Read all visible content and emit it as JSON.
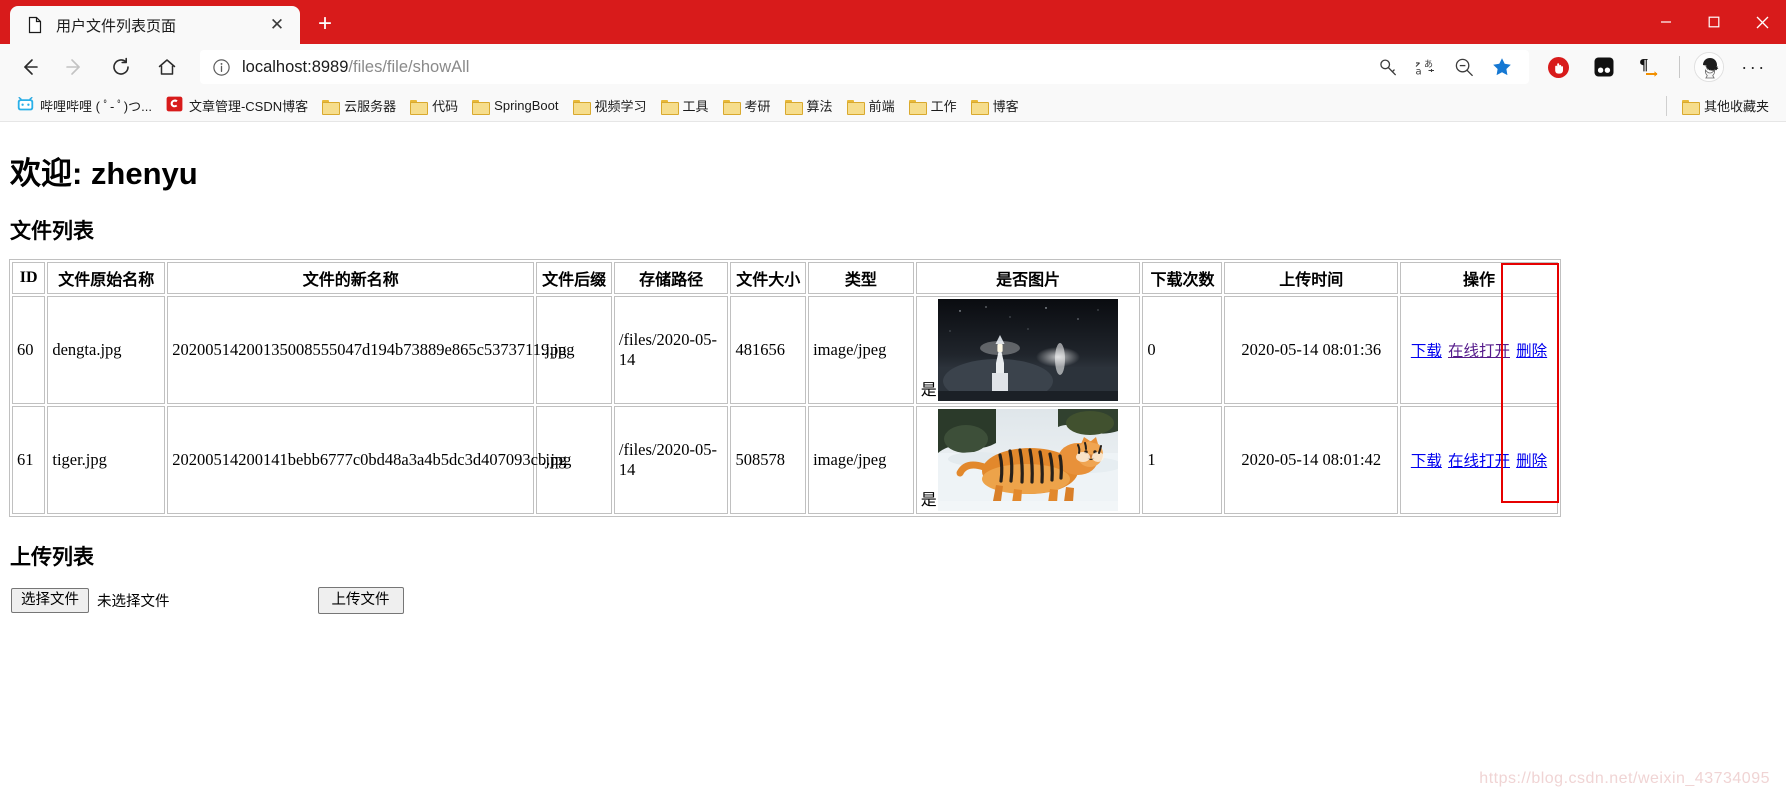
{
  "browser": {
    "tab": {
      "title": "用户文件列表页面",
      "favicon": "page-icon",
      "close": "✕"
    },
    "new_tab": "+",
    "window_controls": {
      "minimize": "minimize-icon",
      "maximize": "maximize-icon",
      "close": "close-icon"
    },
    "nav": {
      "back": "back-arrow-icon",
      "forward": "forward-arrow-icon",
      "reload": "reload-icon",
      "home": "home-icon"
    },
    "address": {
      "info_icon": "info-icon",
      "url_host": "localhost:8989",
      "url_path": "/files/file/showAll",
      "icons": [
        "key-icon",
        "translate-icon",
        "zoom-out-icon",
        "favorites-star-icon"
      ]
    },
    "extensions": [
      "adblock-stop-icon",
      "dark-reader-icon",
      "paragraph-arrow-icon"
    ],
    "profile": "avatar",
    "more": "···",
    "bookmarks": [
      {
        "icon": "bilibili-icon",
        "label": "哔哩哔哩 ( ﾟ- ﾟ)つ..."
      },
      {
        "icon": "csdn-icon",
        "label": "文章管理-CSDN博客"
      },
      {
        "icon": "folder-icon",
        "label": "云服务器"
      },
      {
        "icon": "folder-icon",
        "label": "代码"
      },
      {
        "icon": "folder-icon",
        "label": "SpringBoot"
      },
      {
        "icon": "folder-icon",
        "label": "视频学习"
      },
      {
        "icon": "folder-icon",
        "label": "工具"
      },
      {
        "icon": "folder-icon",
        "label": "考研"
      },
      {
        "icon": "folder-icon",
        "label": "算法"
      },
      {
        "icon": "folder-icon",
        "label": "前端"
      },
      {
        "icon": "folder-icon",
        "label": "工作"
      },
      {
        "icon": "folder-icon",
        "label": "博客"
      }
    ],
    "bookmarks_other": {
      "icon": "folder-icon",
      "label": "其他收藏夹"
    }
  },
  "page": {
    "welcome": "欢迎: zhenyu",
    "file_list_heading": "文件列表",
    "upload_heading": "上传列表",
    "table": {
      "columns": [
        "ID",
        "文件原始名称",
        "文件的新名称",
        "文件后缀",
        "存储路径",
        "文件大小",
        "类型",
        "是否图片",
        "下载次数",
        "上传时间",
        "操作"
      ],
      "rows": [
        {
          "id": "60",
          "original_name": "dengta.jpg",
          "new_name": "20200514200135008555047d194b73889e865c53737119.jpg",
          "ext": ".jpg",
          "path": "/files/2020-05-14",
          "size": "481656",
          "type": "image/jpeg",
          "is_image": "是",
          "thumb": "lighthouse-night-photo",
          "downloads": "0",
          "upload_time": "2020-05-14 08:01:36",
          "ops": [
            {
              "label": "下载",
              "state": "unvisited"
            },
            {
              "label": "在线打开",
              "state": "visited"
            },
            {
              "label": "删除",
              "state": "unvisited"
            }
          ]
        },
        {
          "id": "61",
          "original_name": "tiger.jpg",
          "new_name": "20200514200141bebb6777c0bd48a3a4b5dc3d407093cb.jpg",
          "ext": ".jpg",
          "path": "/files/2020-05-14",
          "size": "508578",
          "type": "image/jpeg",
          "is_image": "是",
          "thumb": "tiger-in-snow-photo",
          "downloads": "1",
          "upload_time": "2020-05-14 08:01:42",
          "ops": [
            {
              "label": "下载",
              "state": "unvisited"
            },
            {
              "label": "在线打开",
              "state": "unvisited"
            },
            {
              "label": "删除",
              "state": "unvisited"
            }
          ]
        }
      ]
    },
    "upload": {
      "choose_file_label": "选择文件",
      "no_file_text": "未选择文件",
      "upload_button_label": "上传文件"
    },
    "watermark": "https://blog.csdn.net/weixin_43734095"
  },
  "colors": {
    "chrome_red": "#d81b1b",
    "link_blue": "#0000ee",
    "link_visited": "#551a8b",
    "annotation_red": "#e60000",
    "star_blue": "#1578d3"
  }
}
